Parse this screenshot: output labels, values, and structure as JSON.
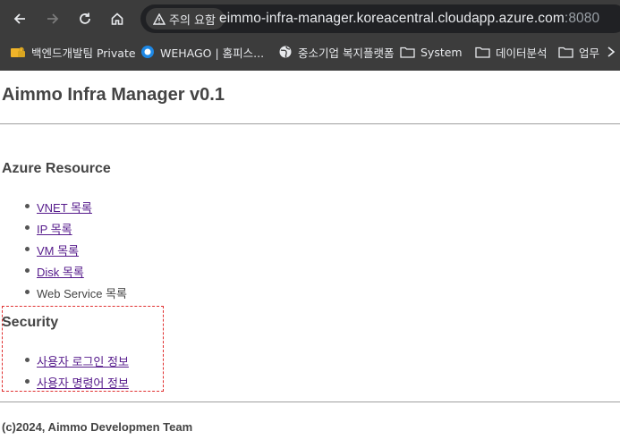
{
  "browser": {
    "security_chip": "주의 요함",
    "url_host": "eimmo-infra-manager.koreacentral.cloudapp.azure.com",
    "url_port": ":8080",
    "bookmarks": [
      {
        "label": "백엔드개발팀 Private",
        "icon": "lock-folder-icon"
      },
      {
        "label": "WEHAGO | 홈피스...",
        "icon": "wehago-logo-icon"
      },
      {
        "label": "중소기업 복지플랫폼",
        "icon": "globe-icon"
      },
      {
        "label": "System",
        "icon": "folder-icon"
      },
      {
        "label": "데이터분석",
        "icon": "folder-icon"
      },
      {
        "label": "업무",
        "icon": "folder-icon"
      }
    ]
  },
  "page": {
    "title": "Aimmo Infra Manager v0.1",
    "azure_section": {
      "heading": "Azure Resource",
      "items": [
        {
          "label": "VNET 목록",
          "link": true
        },
        {
          "label": "IP 목록",
          "link": true
        },
        {
          "label": "VM 목록",
          "link": true
        },
        {
          "label": "Disk 목록",
          "link": true
        },
        {
          "label": "Web Service 목록",
          "link": false
        }
      ]
    },
    "security_section": {
      "heading": "Security",
      "items": [
        {
          "label": "사용자 로그인 정보",
          "link": true
        },
        {
          "label": "사용자 명령어 정보",
          "link": true
        }
      ]
    },
    "footer": "(c)2024, Aimmo Developmen Team"
  },
  "colors": {
    "link": "#551a8b",
    "highlight_box": "#e03030",
    "chrome_bg": "#3c3c3c"
  }
}
